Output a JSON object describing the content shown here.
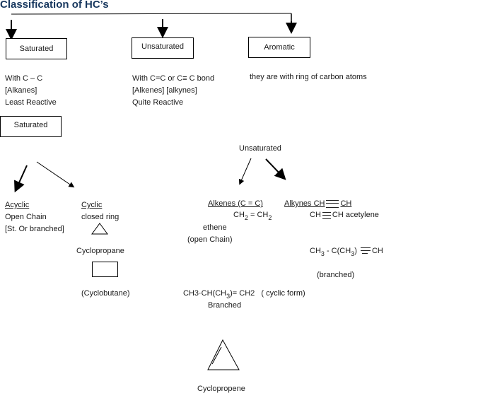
{
  "title": "Classification of HC’s",
  "top_boxes": {
    "saturated": "Saturated",
    "unsaturated": "Unsaturated",
    "aromatic": "Aromatic"
  },
  "descriptions": {
    "saturated": [
      "With C – C",
      "[Alkanes]",
      "Least Reactive"
    ],
    "unsaturated": [
      "With C=C or C≡ C bond",
      "[Alkenes] [alkynes]",
      "Quite Reactive"
    ],
    "aromatic": [
      "they are with ring of carbon atoms"
    ]
  },
  "saturated_section": {
    "box_label": "Saturated",
    "acyclic": {
      "heading": "Acyclic",
      "lines": [
        "Open Chain",
        "[St. Or branched]"
      ]
    },
    "cyclic": {
      "heading": "Cyclic",
      "lines": [
        "closed ring"
      ]
    },
    "cyclopropane": "Cyclopropane",
    "cyclobutane": "(Cyclobutane)"
  },
  "unsaturated_section": {
    "label": "Unsaturated",
    "alkenes": {
      "heading": "Alkenes (C = C)",
      "formula_parts": [
        "CH",
        "2",
        " = CH",
        "2"
      ],
      "name": "ethene",
      "note": "(open Chain)",
      "branched_formula_parts": [
        "CH3",
        "·CH(CH",
        "3",
        ")= CH2"
      ],
      "branched_suffix": "( cyclic form)",
      "branched_label": "Branched",
      "cyclopropene": "Cyclopropene"
    },
    "alkynes": {
      "heading_prefix": "Alkynes CH",
      "heading_suffix": "CH",
      "acetylene_prefix": "CH",
      "acetylene_suffix": "CH acetylene",
      "branched_parts": [
        "CH",
        "3",
        " - C(CH",
        "3",
        ") ",
        "CH"
      ],
      "branched_label": "(branched)"
    }
  }
}
